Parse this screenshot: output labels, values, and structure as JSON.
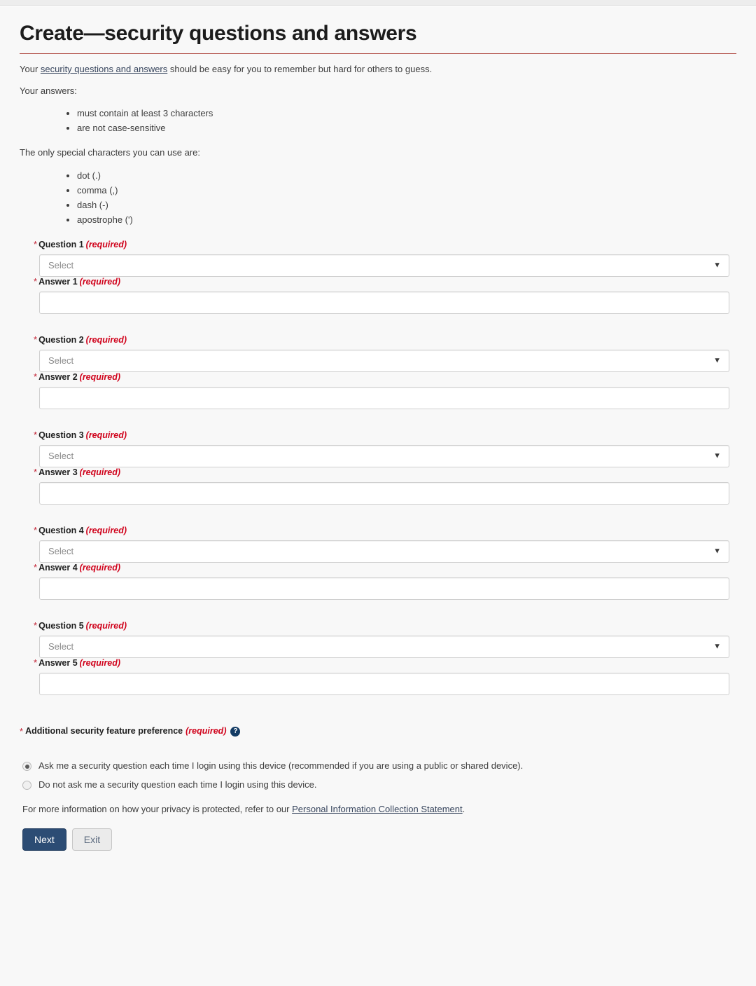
{
  "page": {
    "title": "Create—security questions and answers",
    "accent_rule_color": "#b5554e",
    "background_color": "#f8f8f8"
  },
  "intro": {
    "line1_before_link": "Your ",
    "line1_link": "security questions and answers",
    "line1_after_link": " should be easy for you to remember but hard for others to guess.",
    "answers_heading": "Your answers:",
    "answers_bullets": [
      "must contain at least 3 characters",
      "are not case-sensitive"
    ],
    "special_chars_heading": "The only special characters you can use are:",
    "special_chars_bullets": [
      "dot (.)",
      "comma (,)",
      "dash (-)",
      "apostrophe (')"
    ]
  },
  "form": {
    "required_marker": "*",
    "required_text": "(required)",
    "select_placeholder": "Select",
    "dropdown_arrow_icon": "▼",
    "answer_value": "",
    "pairs": [
      {
        "question_label": "Question 1",
        "answer_label": "Answer 1",
        "selected": "Select",
        "answer_value": ""
      },
      {
        "question_label": "Question 2",
        "answer_label": "Answer 2",
        "selected": "Select",
        "answer_value": ""
      },
      {
        "question_label": "Question 3",
        "answer_label": "Answer 3",
        "selected": "Select",
        "answer_value": ""
      },
      {
        "question_label": "Question 4",
        "answer_label": "Answer 4",
        "selected": "Select",
        "answer_value": ""
      },
      {
        "question_label": "Question 5",
        "answer_label": "Answer 5",
        "selected": "Select",
        "answer_value": ""
      }
    ]
  },
  "preference": {
    "label": "Additional security feature preference",
    "required_marker": "*",
    "required_text": "(required)",
    "help_icon": "help-circle-icon",
    "help_icon_glyph": "?",
    "help_icon_color": "#123a63",
    "options": [
      {
        "label": "Ask me a security question each time I login using this device (recommended if you are using a public or shared device).",
        "selected": true
      },
      {
        "label": "Do not ask me a security question each time I login using this device.",
        "selected": false
      }
    ],
    "privacy_note_before_link": "For more information on how your privacy is protected, refer to our ",
    "privacy_note_link": "Personal Information Collection Statement",
    "privacy_note_after_link": "."
  },
  "actions": {
    "next_label": "Next",
    "exit_label": "Exit",
    "primary_color": "#2c4c74"
  }
}
